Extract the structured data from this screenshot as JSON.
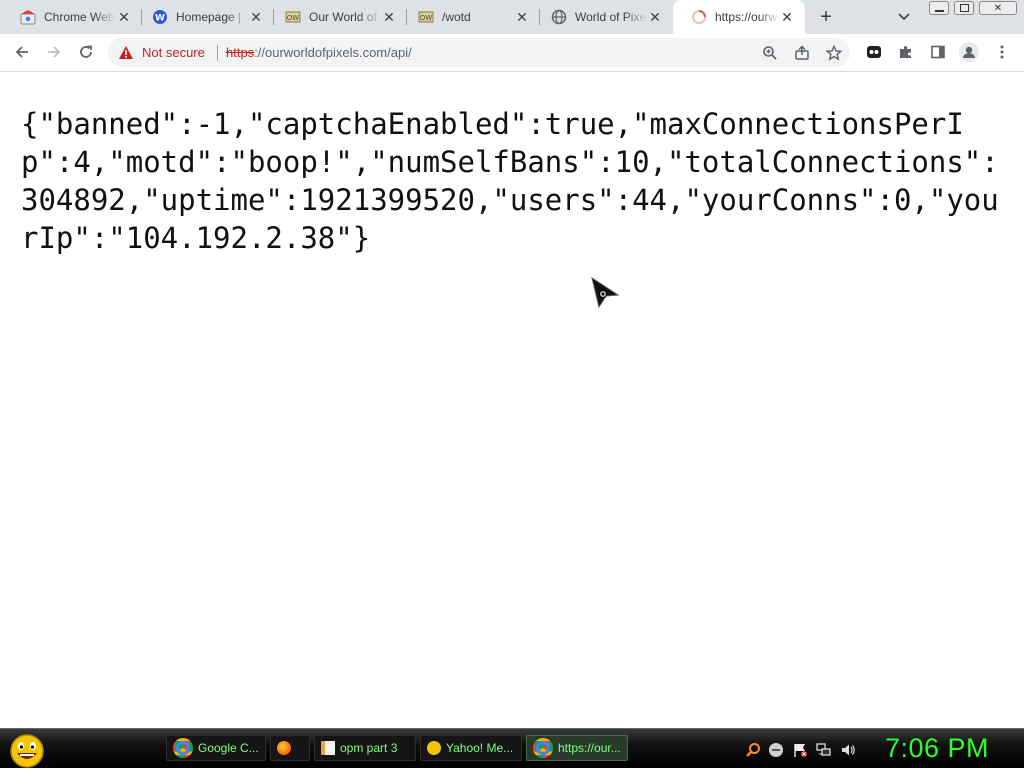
{
  "browser": {
    "tabs": [
      {
        "title": "Chrome Web Store",
        "icon": "chrome-web-store-icon"
      },
      {
        "title": "Homepage | ",
        "icon": "w-globe-icon"
      },
      {
        "title": "Our World of Pixels",
        "icon": "owop-icon"
      },
      {
        "title": "/wotd",
        "icon": "owop-icon"
      },
      {
        "title": "World of Pixels",
        "icon": "globe-icon"
      },
      {
        "title": "https://ourworldofpixels.com/api/",
        "icon": "loading-icon",
        "active": true
      }
    ],
    "new_tab_label": "+",
    "security_text": "Not secure",
    "url_scheme": "https",
    "url_rest": "://ourworldofpixels.com/api/"
  },
  "page": {
    "json_text": "{\"banned\":-1,\"captchaEnabled\":true,\"maxConnectionsPerIp\":4,\"motd\":\"boop!\",\"numSelfBans\":10,\"totalConnections\":304892,\"uptime\":1921399520,\"users\":44,\"yourConns\":0,\"yourIp\":\"104.192.2.38\"}"
  },
  "taskbar": {
    "tasks": [
      {
        "label": "Google C...",
        "icon": "chrome-icon"
      },
      {
        "label": "",
        "icon": "firefox-icon"
      },
      {
        "label": "opm part 3",
        "icon": "document-icon"
      },
      {
        "label": "Yahoo! Me...",
        "icon": "yahoo-messenger-icon"
      },
      {
        "label": "https://our...",
        "icon": "chrome-icon",
        "active": true
      }
    ],
    "clock": "7:06 PM"
  },
  "colors": {
    "tab_strip": "#dee1e6",
    "insecure_red": "#c5221f",
    "clock_green": "#2bff2b",
    "task_text_green": "#7fff7f"
  }
}
